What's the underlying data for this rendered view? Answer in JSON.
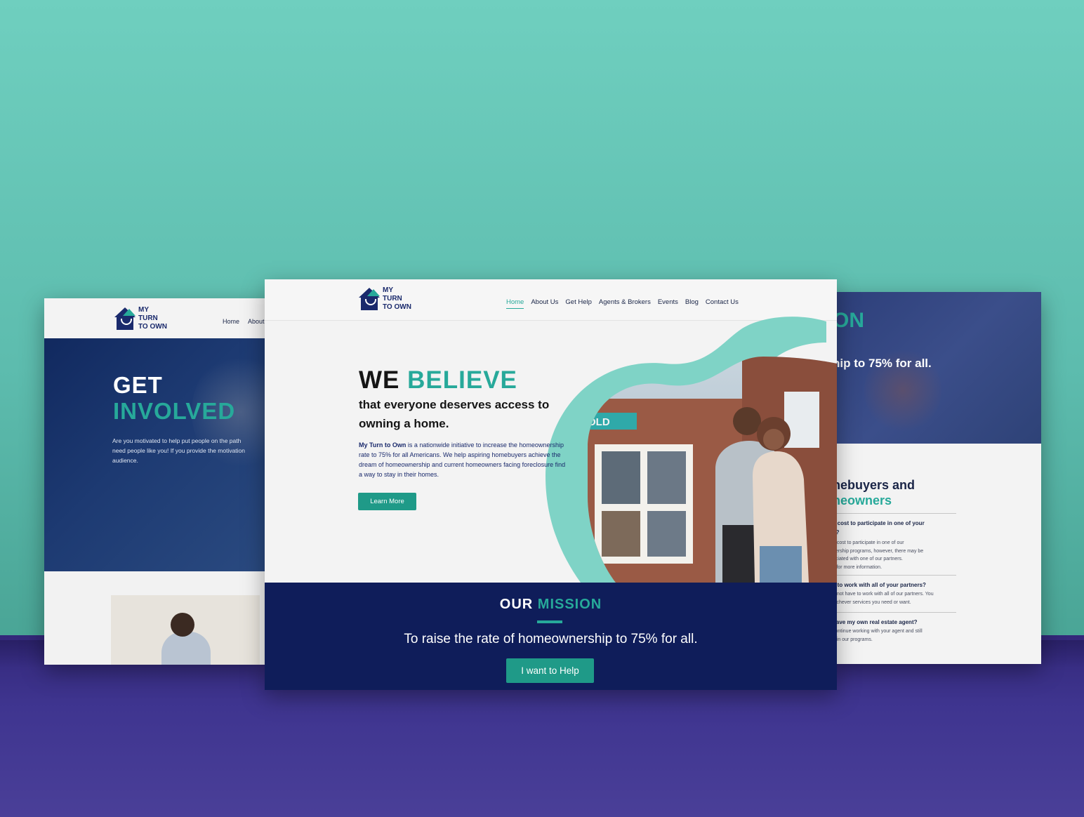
{
  "logo": {
    "text": "MY\nTURN\nTO OWN"
  },
  "left_page": {
    "nav": {
      "home": "Home",
      "about": "About"
    },
    "hero_title_line1": "GET",
    "hero_title_line2": "INVOLVED",
    "hero_paragraph": "Are you motivated to help put people on the path\nneed people like you! If you provide the motivation\naudience."
  },
  "center_page": {
    "nav": [
      "Home",
      "About Us",
      "Get Help",
      "Agents & Brokers",
      "Events",
      "Blog",
      "Contact Us"
    ],
    "active_nav": "Home",
    "headline_word1": "WE",
    "headline_word2": "BELIEVE",
    "subheadline": "that everyone deserves access to owning a home.",
    "description_lead": "My Turn to Own",
    "description_rest": " is a nationwide initiative to increase the homeownership rate to 75% for all Americans. We help aspiring homebuyers achieve the dream of homeownership and current homeowners facing foreclosure find a way to stay in their homes.",
    "learn_more_label": "Learn More",
    "sign_text": "OLD",
    "mission_title_word1": "OUR",
    "mission_title_word2": "MISSION",
    "mission_text": "To raise the rate of homeownership to 75% for all.",
    "help_button_label": "I want to Help"
  },
  "right_page": {
    "hero_title": "ON",
    "hero_subtitle": "nip to 75% for all.",
    "section_title_line1": "nebuyers and",
    "section_title_line2": "neowners",
    "faq": [
      {
        "q": "a cost to participate in one of your\ns?",
        "a": "o cost to participate in one of our\nnership programs, however, there may be\nociated with one of our partners.\ns for more information."
      },
      {
        "q": "e to work with all of your partners?",
        "a": "o not have to work with all of our partners. You\nhichever services you need or want."
      },
      {
        "q": "have my own real estate agent?",
        "a": "continue working with your agent and still\ne in our programs."
      }
    ]
  },
  "colors": {
    "teal": "#27a99a",
    "navy": "#0f1d5a",
    "background": "#5dbcae",
    "floor": "#3f3590"
  }
}
